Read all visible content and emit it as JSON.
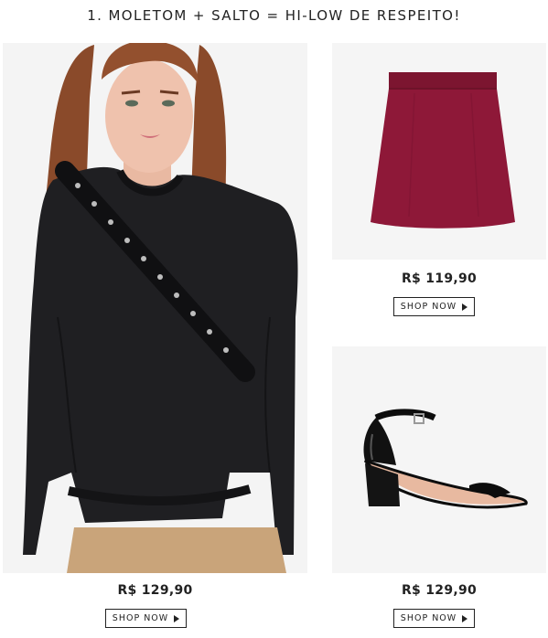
{
  "heading": "1. MOLETOM + SALTO = HI-LOW DE RESPEITO!",
  "products": {
    "sweatshirt": {
      "price": "R$ 129,90",
      "cta": "SHOP NOW"
    },
    "skirt": {
      "price": "R$ 119,90",
      "cta": "SHOP NOW"
    },
    "sandal": {
      "price": "R$ 129,90",
      "cta": "SHOP NOW"
    }
  },
  "colors": {
    "background": "#ffffff",
    "panel": "#f5f5f5",
    "sweatshirt": "#1f1f22",
    "skirt": "#8e1838",
    "sandal": "#101010",
    "text": "#222222"
  },
  "icons": [
    "play-arrow-icon"
  ]
}
